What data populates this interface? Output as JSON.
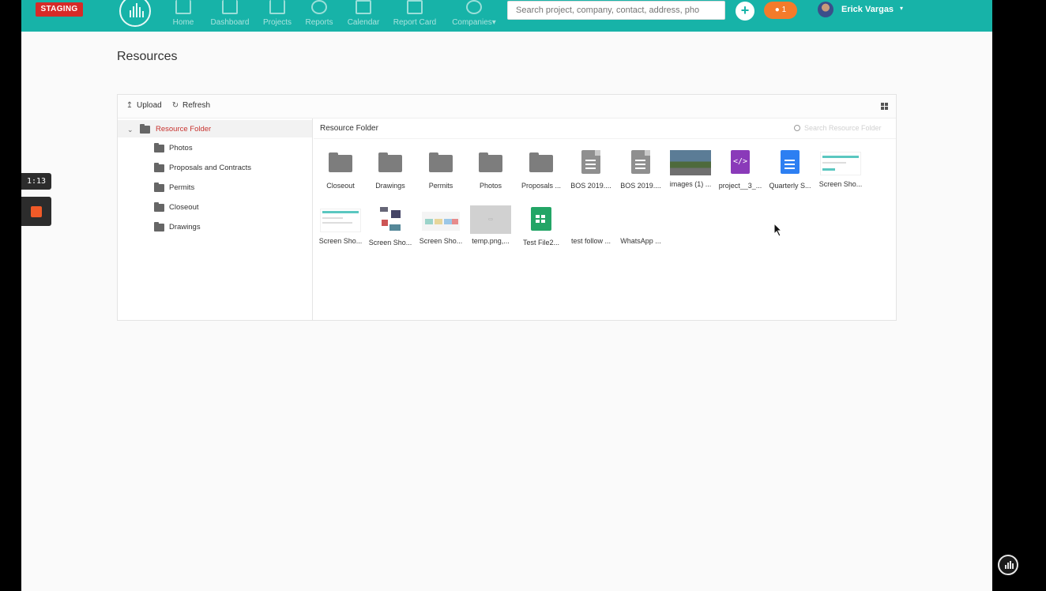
{
  "topbar": {
    "env_badge": "STAGING",
    "nav": [
      {
        "label": "Home"
      },
      {
        "label": "Dashboard"
      },
      {
        "label": "Projects"
      },
      {
        "label": "Reports"
      },
      {
        "label": "Calendar"
      },
      {
        "label": "Report Card"
      },
      {
        "label": "Companies"
      }
    ],
    "companies_caret": "▾",
    "search_placeholder": "Search project, company, contact, address, pho",
    "add_button": "+",
    "notification_count": "1",
    "user_name": "Erick Vargas",
    "user_caret": "▾",
    "accent_color": "#17b3a8"
  },
  "page": {
    "title": "Resources"
  },
  "toolbar": {
    "upload_label": "Upload",
    "refresh_label": "Refresh"
  },
  "tree": {
    "root": "Resource Folder",
    "children": [
      "Photos",
      "Proposals and Contracts",
      "Permits",
      "Closeout",
      "Drawings"
    ]
  },
  "main": {
    "breadcrumb": "Resource Folder",
    "search_placeholder": "Search Resource Folder",
    "files": [
      {
        "name": "Closeout",
        "kind": "folder"
      },
      {
        "name": "Drawings",
        "kind": "folder"
      },
      {
        "name": "Permits",
        "kind": "folder"
      },
      {
        "name": "Photos",
        "kind": "folder"
      },
      {
        "name": "Proposals ...",
        "kind": "folder"
      },
      {
        "name": "BOS 2019....",
        "kind": "doc"
      },
      {
        "name": "BOS 2019....",
        "kind": "doc"
      },
      {
        "name": "images (1) ...",
        "kind": "photo"
      },
      {
        "name": "project__3_...",
        "kind": "code"
      },
      {
        "name": "Quarterly S...",
        "kind": "gdoc"
      },
      {
        "name": "Screen Sho...",
        "kind": "screenshot"
      },
      {
        "name": "Screen Sho...",
        "kind": "screenshot"
      },
      {
        "name": "Screen Sho...",
        "kind": "screenshot"
      },
      {
        "name": "Screen Sho...",
        "kind": "screenshot"
      },
      {
        "name": "temp.png,...",
        "kind": "image"
      },
      {
        "name": "Test File2...",
        "kind": "gsheet"
      },
      {
        "name": "test follow ...",
        "kind": "blank"
      },
      {
        "name": "WhatsApp ...",
        "kind": "blank"
      }
    ]
  },
  "recorder": {
    "elapsed": "1:13"
  },
  "icons": {
    "upload": "upload-icon",
    "refresh": "refresh-icon",
    "grid": "grid-view-icon",
    "folder": "folder-icon",
    "search": "search-icon"
  }
}
